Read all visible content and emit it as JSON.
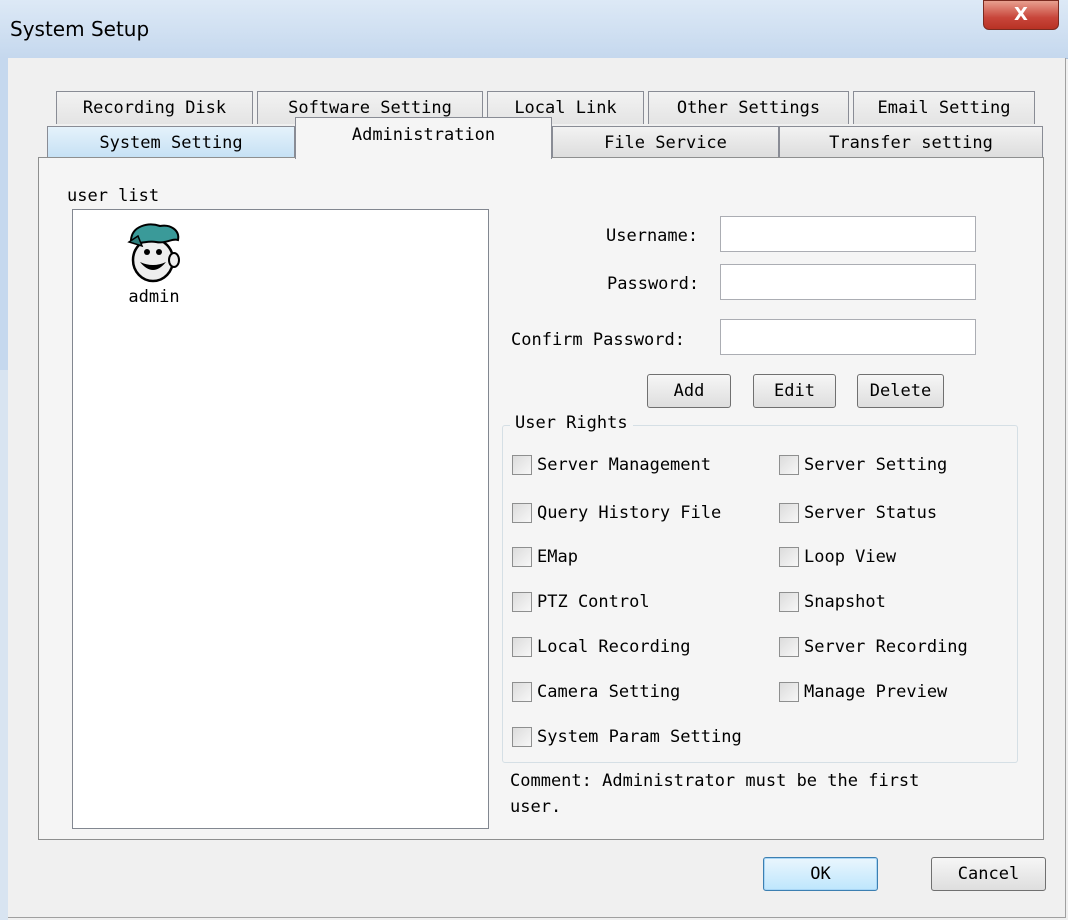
{
  "window": {
    "title": "System Setup",
    "close_label": "X"
  },
  "tabs_row1": [
    "Recording Disk",
    "Software Setting",
    "Local Link",
    "Other Settings",
    "Email Setting"
  ],
  "tabs_row2": [
    "System Setting",
    "Administration",
    "File Service",
    "Transfer setting"
  ],
  "active_tab": "Administration",
  "user_list": {
    "label": "user list",
    "users": [
      {
        "name": "admin",
        "icon": "user-avatar-icon"
      }
    ]
  },
  "form": {
    "username_label": "Username:",
    "password_label": "Password:",
    "confirm_label": "Confirm Password:",
    "username_value": "",
    "password_value": "",
    "confirm_value": "",
    "add": "Add",
    "edit": "Edit",
    "delete": "Delete"
  },
  "rights": {
    "label": "User Rights",
    "items": [
      {
        "label": "Server Management",
        "checked": false
      },
      {
        "label": "Server Setting",
        "checked": false
      },
      {
        "label": "Query History File",
        "checked": false
      },
      {
        "label": "Server Status",
        "checked": false
      },
      {
        "label": "EMap",
        "checked": false
      },
      {
        "label": "Loop View",
        "checked": false
      },
      {
        "label": "PTZ Control",
        "checked": false
      },
      {
        "label": "Snapshot",
        "checked": false
      },
      {
        "label": "Local Recording",
        "checked": false
      },
      {
        "label": "Server Recording",
        "checked": false
      },
      {
        "label": "Camera Setting",
        "checked": false
      },
      {
        "label": "Manage Preview",
        "checked": false
      },
      {
        "label": "System Param Setting",
        "checked": false
      }
    ]
  },
  "comment": {
    "line1": "Comment: Administrator must be the first",
    "line2": "user."
  },
  "footer": {
    "ok": "OK",
    "cancel": "Cancel"
  }
}
